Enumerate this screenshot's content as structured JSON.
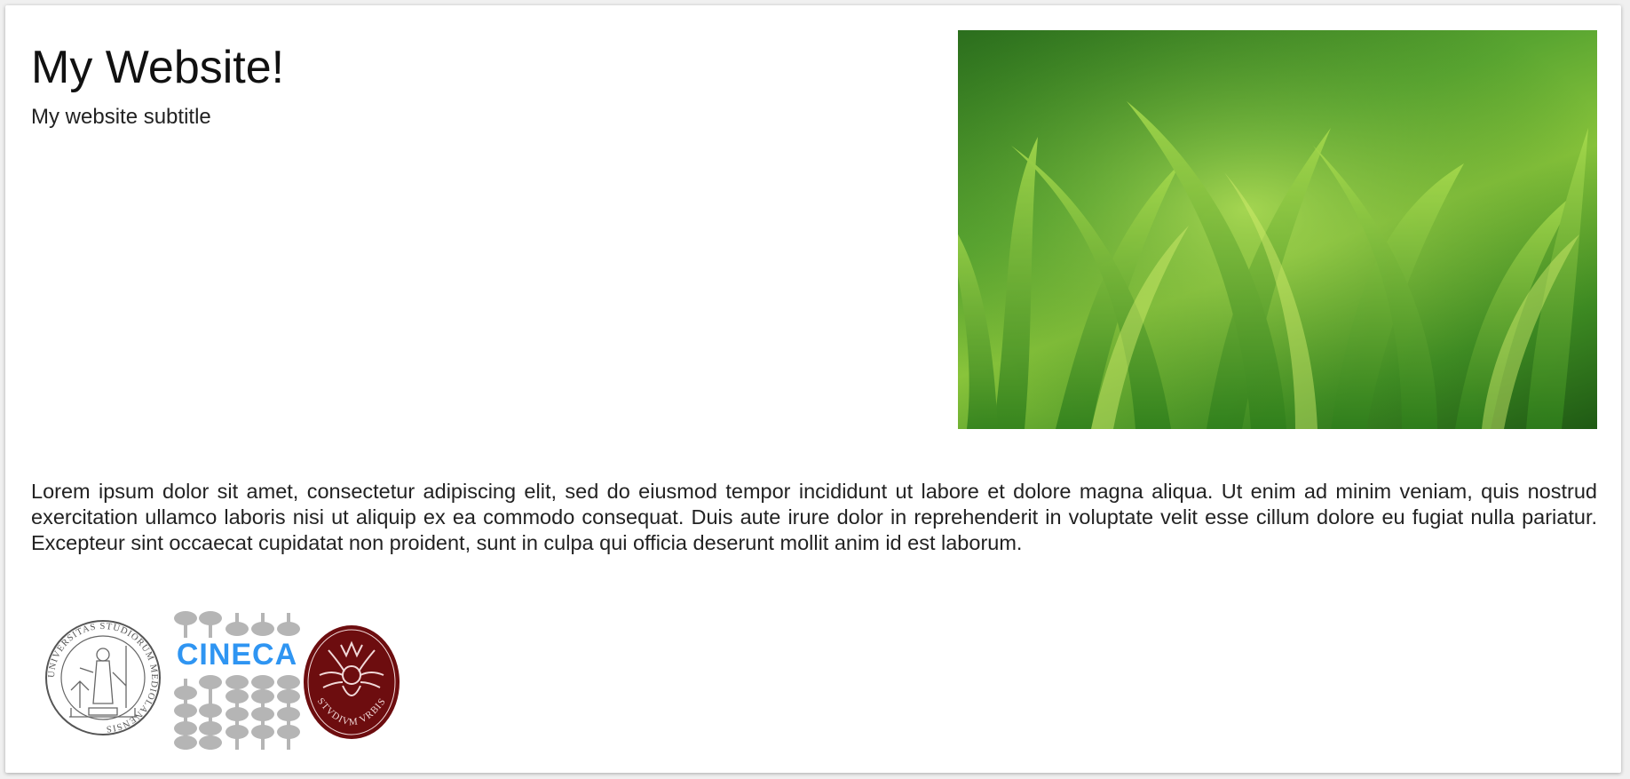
{
  "header": {
    "title": "My Website!",
    "subtitle": "My website subtitle"
  },
  "hero_image": {
    "icon": "grass-photo",
    "alt": "Close-up of green grass blades"
  },
  "content": {
    "paragraph": "Lorem ipsum dolor sit amet, consectetur adipiscing elit, sed do eiusmod tempor incididunt ut labore et dolore magna aliqua. Ut enim ad minim veniam, quis nostrud exercitation ullamco laboris nisi ut aliquip ex ea commodo consequat. Duis aute irure dolor in reprehenderit in voluptate velit esse cillum dolore eu fugiat nulla pariatur. Excepteur sint occaecat cupidatat non proident, sunt in culpa qui officia deserunt mollit anim id est laborum."
  },
  "logos": [
    {
      "icon": "university-seal-icon",
      "text": "UNIVERSITAS STUDIORUM MEDIOLANENSIS",
      "color": "#555555"
    },
    {
      "icon": "cineca-logo-icon",
      "text": "CINECA",
      "color": "#2f95f2",
      "bead_color": "#b5b5b5"
    },
    {
      "icon": "sapienza-seal-icon",
      "text": "STVDIVM VRBIS",
      "color": "#6d0d0f"
    }
  ],
  "colors": {
    "page_background": "#f0f0f0",
    "card_background": "#ffffff",
    "text": "#222222"
  }
}
